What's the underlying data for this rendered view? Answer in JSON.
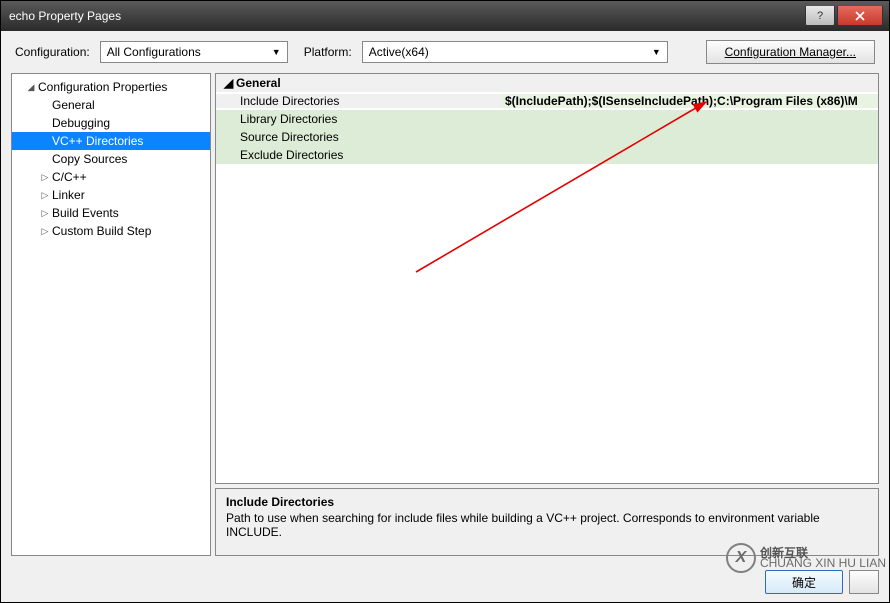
{
  "window": {
    "title": "echo Property Pages"
  },
  "toolbar": {
    "config_label": "Configuration:",
    "config_value": "All Configurations",
    "platform_label": "Platform:",
    "platform_value": "Active(x64)",
    "manager_label": "Configuration Manager..."
  },
  "tree": {
    "root": "Configuration Properties",
    "items": [
      {
        "label": "General",
        "exp": ""
      },
      {
        "label": "Debugging",
        "exp": ""
      },
      {
        "label": "VC++ Directories",
        "exp": "",
        "selected": true
      },
      {
        "label": "Copy Sources",
        "exp": ""
      },
      {
        "label": "C/C++",
        "exp": "▷"
      },
      {
        "label": "Linker",
        "exp": "▷"
      },
      {
        "label": "Build Events",
        "exp": "▷"
      },
      {
        "label": "Custom Build Step",
        "exp": "▷"
      }
    ]
  },
  "grid": {
    "category": "General",
    "rows": [
      {
        "label": "Include Directories",
        "value": "$(IncludePath);$(ISenseIncludePath);C:\\Program Files (x86)\\M",
        "highlight": true
      },
      {
        "label": "Library Directories",
        "value": ""
      },
      {
        "label": "Source Directories",
        "value": ""
      },
      {
        "label": "Exclude Directories",
        "value": ""
      }
    ]
  },
  "desc": {
    "title": "Include Directories",
    "text": "Path to use when searching for include files while building a VC++ project.  Corresponds to environment variable INCLUDE."
  },
  "footer": {
    "ok": "确定"
  },
  "watermark": {
    "big": "创新互联",
    "small": "CHUANG XIN HU LIAN"
  }
}
